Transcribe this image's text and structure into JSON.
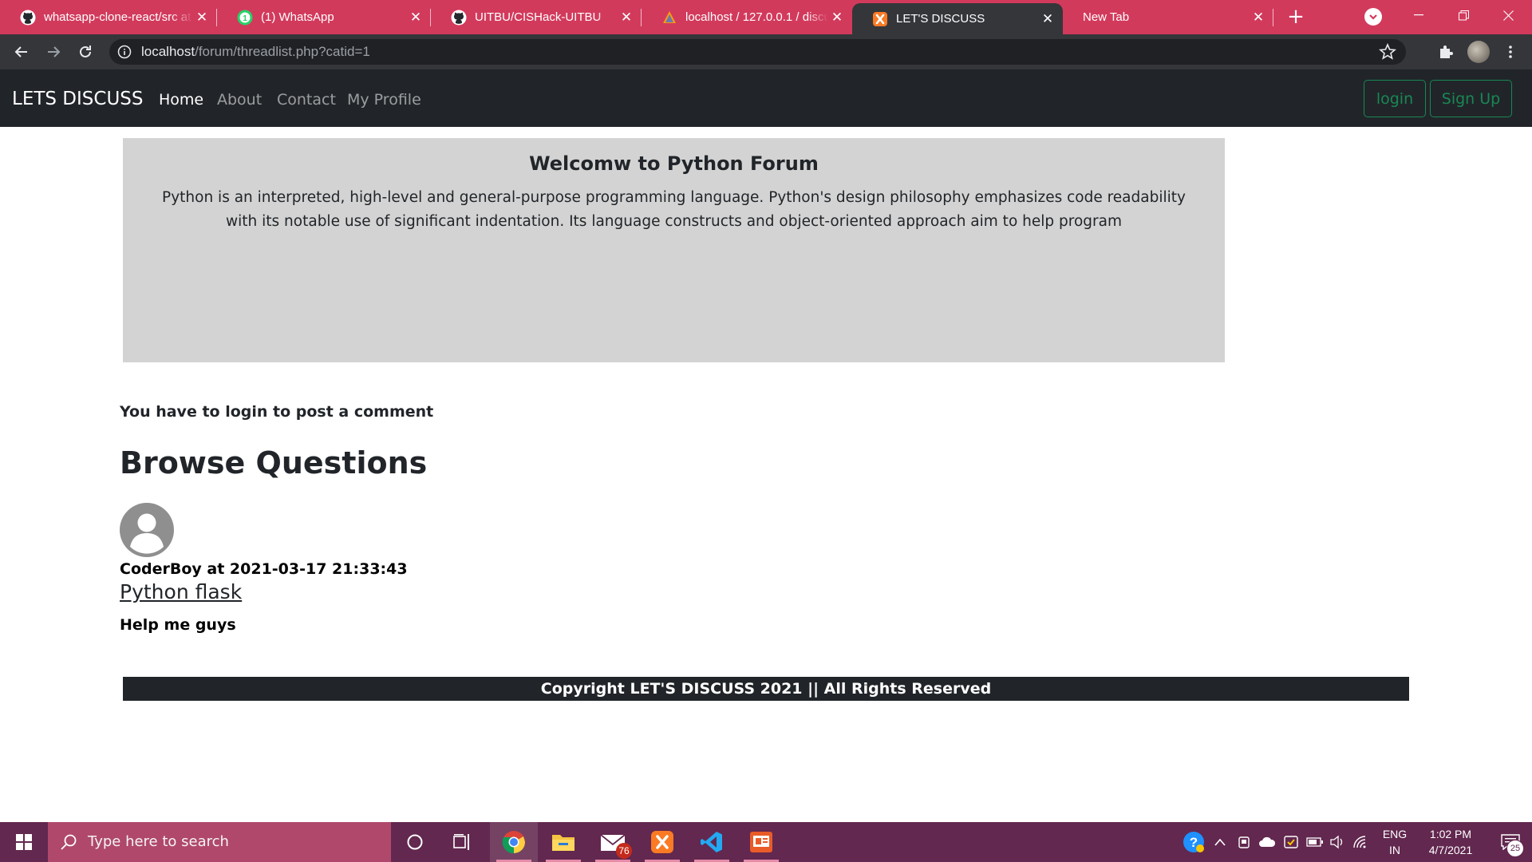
{
  "browser": {
    "tabs": [
      {
        "title": "whatsapp-clone-react/src at master",
        "icon": "github-icon",
        "active": false
      },
      {
        "title": "(1) WhatsApp",
        "icon": "whatsapp-icon",
        "active": false
      },
      {
        "title": "UITBU/CISHack-UITBU",
        "icon": "github-icon",
        "active": false
      },
      {
        "title": "localhost / 127.0.0.1 / discuss",
        "icon": "phpmyadmin-icon",
        "active": false
      },
      {
        "title": "LET'S DISCUSS",
        "icon": "xampp-icon",
        "active": true
      },
      {
        "title": "New Tab",
        "icon": "",
        "active": false
      }
    ],
    "address": {
      "host": "localhost",
      "path": "/forum/threadlist.php?catid=1"
    },
    "colors": {
      "tabstrip": "#d23a5c",
      "toolbar": "#35363a"
    }
  },
  "site": {
    "brand": "LETS DISCUSS",
    "nav": {
      "home": "Home",
      "about": "About",
      "contact": "Contact",
      "profile": "My Profile"
    },
    "buttons": {
      "login": "login",
      "signup": "Sign Up"
    },
    "accent": "#198754"
  },
  "category": {
    "title": "Welcomw to Python Forum",
    "description": "Python is an interpreted, high-level and general-purpose programming language. Python's design philosophy emphasizes code readability with its notable use of significant indentation. Its language constructs and object-oriented approach aim to help program"
  },
  "notice": "You have to login to post a comment",
  "browse_heading": "Browse Questions",
  "thread": {
    "meta": "CoderBoy at 2021-03-17 21:33:43",
    "title": "Python flask",
    "description": "Help me guys"
  },
  "footer": "Copyright LET'S DISCUSS 2021 || All Rights Reserved",
  "taskbar": {
    "search_placeholder": "Type here to search",
    "mail_badge": "76",
    "language": {
      "line1": "ENG",
      "line2": "IN"
    },
    "time": "1:02 PM",
    "date": "4/7/2021",
    "notifications": "25",
    "color": "#62284f"
  }
}
